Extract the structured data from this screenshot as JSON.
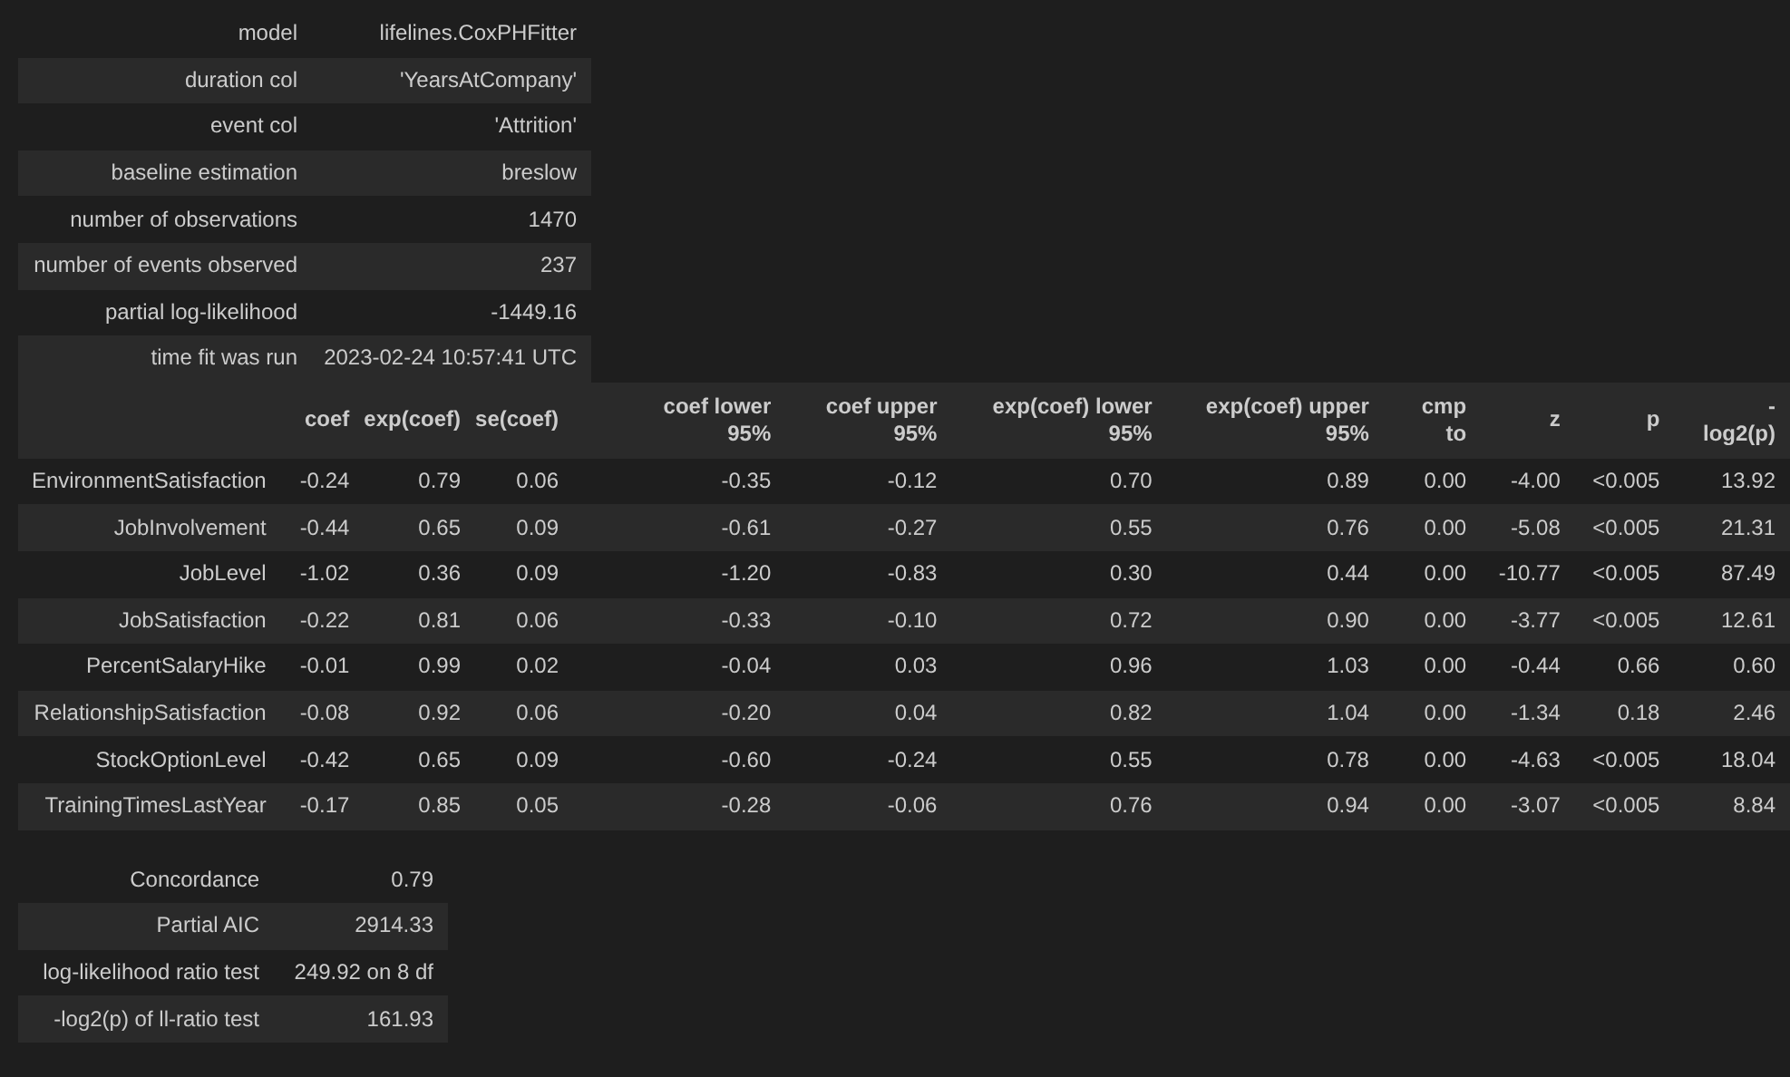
{
  "model_info": [
    {
      "label": "model",
      "value": "lifelines.CoxPHFitter"
    },
    {
      "label": "duration col",
      "value": "'YearsAtCompany'"
    },
    {
      "label": "event col",
      "value": "'Attrition'"
    },
    {
      "label": "baseline estimation",
      "value": "breslow"
    },
    {
      "label": "number of observations",
      "value": "1470"
    },
    {
      "label": "number of events observed",
      "value": "237"
    },
    {
      "label": "partial log-likelihood",
      "value": "-1449.16"
    },
    {
      "label": "time fit was run",
      "value": "2023-02-24 10:57:41 UTC"
    }
  ],
  "coefficients": {
    "columns": [
      {
        "lines": [
          "coef"
        ]
      },
      {
        "lines": [
          "exp(coef)"
        ]
      },
      {
        "lines": [
          "se(coef)"
        ]
      },
      {
        "lines": [
          "coef lower",
          "95%"
        ]
      },
      {
        "lines": [
          "coef upper",
          "95%"
        ]
      },
      {
        "lines": [
          "exp(coef) lower",
          "95%"
        ]
      },
      {
        "lines": [
          "exp(coef) upper",
          "95%"
        ]
      },
      {
        "lines": [
          "cmp",
          "to"
        ]
      },
      {
        "lines": [
          "z"
        ]
      },
      {
        "lines": [
          "p"
        ]
      },
      {
        "lines": [
          "-",
          "log2(p)"
        ]
      }
    ],
    "rows": [
      {
        "name": "EnvironmentSatisfaction",
        "values": [
          "-0.24",
          "0.79",
          "0.06",
          "-0.35",
          "-0.12",
          "0.70",
          "0.89",
          "0.00",
          "-4.00",
          "<0.005",
          "13.92"
        ]
      },
      {
        "name": "JobInvolvement",
        "values": [
          "-0.44",
          "0.65",
          "0.09",
          "-0.61",
          "-0.27",
          "0.55",
          "0.76",
          "0.00",
          "-5.08",
          "<0.005",
          "21.31"
        ]
      },
      {
        "name": "JobLevel",
        "values": [
          "-1.02",
          "0.36",
          "0.09",
          "-1.20",
          "-0.83",
          "0.30",
          "0.44",
          "0.00",
          "-10.77",
          "<0.005",
          "87.49"
        ]
      },
      {
        "name": "JobSatisfaction",
        "values": [
          "-0.22",
          "0.81",
          "0.06",
          "-0.33",
          "-0.10",
          "0.72",
          "0.90",
          "0.00",
          "-3.77",
          "<0.005",
          "12.61"
        ]
      },
      {
        "name": "PercentSalaryHike",
        "values": [
          "-0.01",
          "0.99",
          "0.02",
          "-0.04",
          "0.03",
          "0.96",
          "1.03",
          "0.00",
          "-0.44",
          "0.66",
          "0.60"
        ]
      },
      {
        "name": "RelationshipSatisfaction",
        "values": [
          "-0.08",
          "0.92",
          "0.06",
          "-0.20",
          "0.04",
          "0.82",
          "1.04",
          "0.00",
          "-1.34",
          "0.18",
          "2.46"
        ]
      },
      {
        "name": "StockOptionLevel",
        "values": [
          "-0.42",
          "0.65",
          "0.09",
          "-0.60",
          "-0.24",
          "0.55",
          "0.78",
          "0.00",
          "-4.63",
          "<0.005",
          "18.04"
        ]
      },
      {
        "name": "TrainingTimesLastYear",
        "values": [
          "-0.17",
          "0.85",
          "0.05",
          "-0.28",
          "-0.06",
          "0.76",
          "0.94",
          "0.00",
          "-3.07",
          "<0.005",
          "8.84"
        ]
      }
    ]
  },
  "fit_stats": [
    {
      "label": "Concordance",
      "value": "0.79"
    },
    {
      "label": "Partial AIC",
      "value": "2914.33"
    },
    {
      "label": "log-likelihood ratio test",
      "value": "249.92 on 8 df"
    },
    {
      "label": "-log2(p) of ll-ratio test",
      "value": "161.93"
    }
  ]
}
